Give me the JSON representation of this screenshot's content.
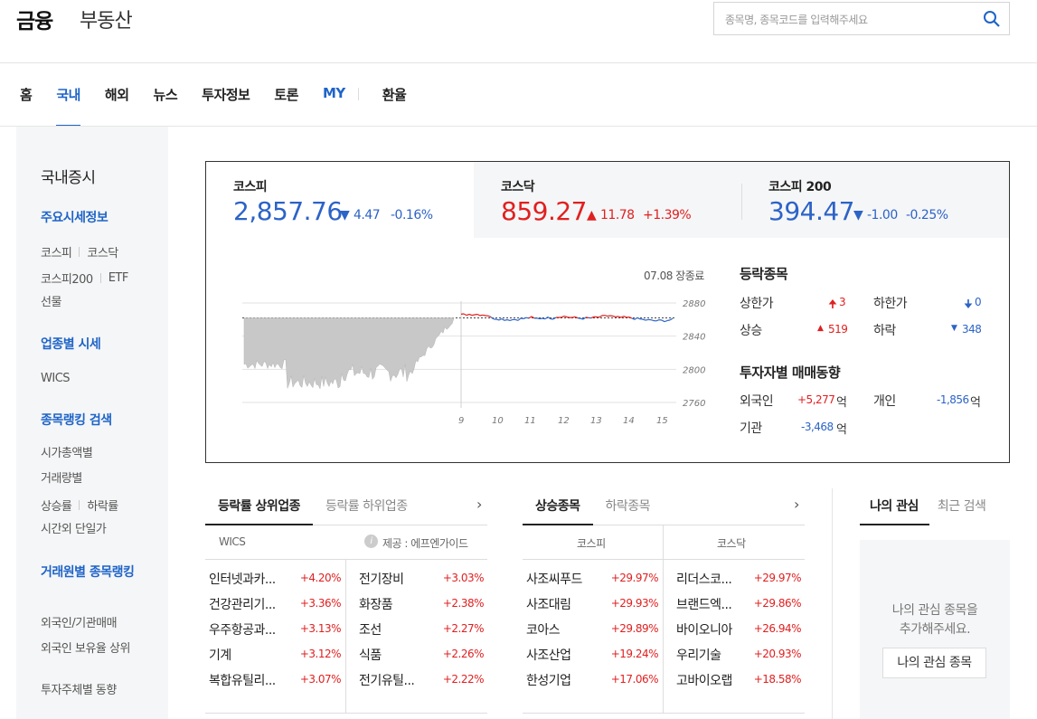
{
  "header": {
    "brand": "금융",
    "sub_brand": "부동산",
    "search_placeholder": "종목명, 종목코드를 입력해주세요"
  },
  "nav": {
    "items": [
      "홈",
      "국내",
      "해외",
      "뉴스",
      "투자정보",
      "토론",
      "MY"
    ],
    "active": "국내",
    "extra": "환율"
  },
  "sidebar": {
    "title": "국내증시",
    "section1": "주요시세정보",
    "s1_row1": [
      "코스피",
      "코스닥"
    ],
    "s1_row2": [
      "코스피200",
      "ETF"
    ],
    "s1_item3": "선물",
    "section2": "업종별 시세",
    "s2_item1": "WICS",
    "section3": "종목랭킹 검색",
    "s3_item1": "시가총액별",
    "s3_item2": "거래량별",
    "s3_row3": [
      "상승률",
      "하락률"
    ],
    "s3_item4": "시간외 단일가",
    "section4": "거래원별 종목랭킹",
    "s4_item1": "외국인/기관매매",
    "s4_item2": "외국인 보유율 상위",
    "s4_item3": "투자주체별 동향"
  },
  "indices": [
    {
      "name": "코스피",
      "value": "2,857.76",
      "change": "4.47",
      "rate": "-0.16%",
      "direction": "down"
    },
    {
      "name": "코스닥",
      "value": "859.27",
      "change": "11.78",
      "rate": "+1.39%",
      "direction": "up"
    },
    {
      "name": "코스피 200",
      "value": "394.47",
      "change": "-1.00",
      "rate": "-0.25%",
      "direction": "down"
    }
  ],
  "chart_date": "07.08 장종료",
  "chart_data": {
    "type": "area",
    "ylim": [
      2760,
      2880
    ],
    "y_ticks": [
      "2880",
      "2840",
      "2800",
      "2760"
    ],
    "x_ticks": [
      "9",
      "10",
      "11",
      "12",
      "13",
      "14",
      "15"
    ],
    "reference_line": 2862,
    "colors": {
      "area": "#c8c8c8",
      "up": "#e02020",
      "down": "#2c63c7"
    }
  },
  "breadth": {
    "title": "등락종목",
    "upper_limit_label": "상한가",
    "upper_limit": "3",
    "lower_limit_label": "하한가",
    "lower_limit": "0",
    "rise_label": "상승",
    "rise": "519",
    "fall_label": "하락",
    "fall": "348"
  },
  "investors": {
    "title": "투자자별 매매동향",
    "foreign_label": "외국인",
    "foreign": "+5,277",
    "individual_label": "개인",
    "individual": "-1,856",
    "institution_label": "기관",
    "institution": "-3,468",
    "unit": "억"
  },
  "sector_block": {
    "tab_on": "등락률 상위업종",
    "tab_off": "등락률 하위업종",
    "source_left": "WICS",
    "source_right": "제공 : 에프엔가이드",
    "left": [
      {
        "name": "인터넷과카...",
        "rate": "+4.20%"
      },
      {
        "name": "건강관리기...",
        "rate": "+3.36%"
      },
      {
        "name": "우주항공과...",
        "rate": "+3.13%"
      },
      {
        "name": "기계",
        "rate": "+3.12%"
      },
      {
        "name": "복합유틸리...",
        "rate": "+3.07%"
      }
    ],
    "right": [
      {
        "name": "전기장비",
        "rate": "+3.03%"
      },
      {
        "name": "화장품",
        "rate": "+2.38%"
      },
      {
        "name": "조선",
        "rate": "+2.27%"
      },
      {
        "name": "식품",
        "rate": "+2.26%"
      },
      {
        "name": "전기유틸...",
        "rate": "+2.22%"
      }
    ]
  },
  "stock_block": {
    "tab_on": "상승종목",
    "tab_off": "하락종목",
    "col_left": "코스피",
    "col_right": "코스닥",
    "left": [
      {
        "name": "사조씨푸드",
        "rate": "+29.97%"
      },
      {
        "name": "사조대림",
        "rate": "+29.93%"
      },
      {
        "name": "코아스",
        "rate": "+29.89%"
      },
      {
        "name": "사조산업",
        "rate": "+19.24%"
      },
      {
        "name": "한성기업",
        "rate": "+17.06%"
      }
    ],
    "right": [
      {
        "name": "리더스코...",
        "rate": "+29.97%"
      },
      {
        "name": "브랜드엑...",
        "rate": "+29.86%"
      },
      {
        "name": "바이오니아",
        "rate": "+26.94%"
      },
      {
        "name": "우리기술",
        "rate": "+20.93%"
      },
      {
        "name": "고바이오랩",
        "rate": "+18.58%"
      }
    ]
  },
  "watch_block": {
    "tab_on": "나의 관심",
    "tab_off": "최근 검색",
    "message_line1": "나의 관심 종목을",
    "message_line2": "추가해주세요.",
    "button": "나의 관심 종목"
  }
}
